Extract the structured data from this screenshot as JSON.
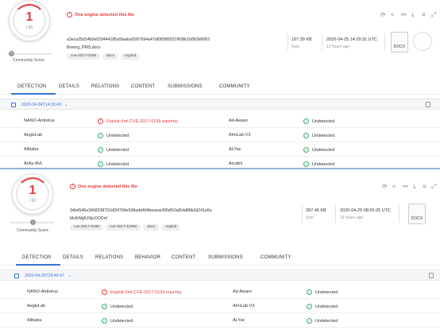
{
  "alert_icon": "!",
  "ok_glyph": "✓",
  "top": {
    "score_detected": "1",
    "score_total": "/ 60",
    "community_knob": "?",
    "community_label": "Community Score",
    "alert": "One engine detected this file",
    "hash": "a3eca35d14b0e020444186a5faaba5997994a47af08580521f608b1b863d6063",
    "filename": "Boeing_PMS.docx",
    "tags": [
      "cve-2017-0199",
      "docx",
      "exploit"
    ],
    "size_value": "197.39 KB",
    "size_label": "Size",
    "date_value": "2020-04-25 14:29:31 UTC",
    "date_sub": "13 hours ago",
    "filetype": "DOCX",
    "tabs": [
      "DETECTION",
      "DETAILS",
      "RELATIONS",
      "CONTENT",
      "SUBMISSIONS",
      "COMMUNITY"
    ],
    "analysis_date": "2020-04-24T14:33:43",
    "rows": [
      {
        "e1": "NANO-Antivirus",
        "r1": "Exploit.Xml.CVE-2017-0199.equmby",
        "bad1": true,
        "e2": "Ad-Aware",
        "r2": "Undetected"
      },
      {
        "e1": "AegisLab",
        "r1": "Undetected",
        "bad1": false,
        "e2": "AhnLab-V3",
        "r2": "Undetected"
      },
      {
        "e1": "Alibaba",
        "r1": "Undetected",
        "bad1": false,
        "e2": "ALYac",
        "r2": "Undetected"
      },
      {
        "e1": "Antiy-AVL",
        "r1": "Undetected",
        "bad1": false,
        "e2": "Arcabit",
        "r2": "Undetected"
      }
    ]
  },
  "bottom": {
    "score_detected": "1",
    "score_total": "/ 63",
    "community_knob": "?",
    "community_label": "Community Score",
    "alert": "One engine detected this file",
    "hash": "34b4546e3468238702df24794e598add494beaeacf95df10af54d88b3d241e8a",
    "filename": "Mz8rMjA1NjcOODnf",
    "tags": [
      "cve-2017-0199",
      "cve-2017-11882",
      "docx",
      "exploit"
    ],
    "size_value": "287.46 KB",
    "size_label": "Size",
    "date_value": "2020-04-25 08:55:25 UTC",
    "date_sub": "19 hours ago",
    "filetype": "DOCX",
    "tabs": [
      "DETECTION",
      "DETAILS",
      "RELATIONS",
      "BEHAVIOR",
      "CONTENT",
      "SUBMISSIONS",
      "COMMUNITY"
    ],
    "analysis_date": "2020-04-20T23:40:47",
    "rows": [
      {
        "e1": "NANO-Antivirus",
        "r1": "Exploit.Xml.CVE-2017-0199.equmby",
        "bad1": true,
        "e2": "Ad-Aware",
        "r2": "Undetected"
      },
      {
        "e1": "AegisLab",
        "r1": "Undetected",
        "bad1": false,
        "e2": "AhnLab-V3",
        "r2": "Undetected"
      },
      {
        "e1": "Alibaba",
        "r1": "Undetected",
        "bad1": false,
        "e2": "ALYac",
        "r2": "Undetected"
      }
    ]
  },
  "toolbar_icons": [
    "reanalyze-icon",
    "similar-icon",
    "graph-icon",
    "download-icon",
    "more-icon",
    "expand-icon"
  ],
  "toolbar_glyphs": [
    "⟳",
    "≈",
    "⚯",
    "⤓",
    "≡",
    "⤢"
  ]
}
